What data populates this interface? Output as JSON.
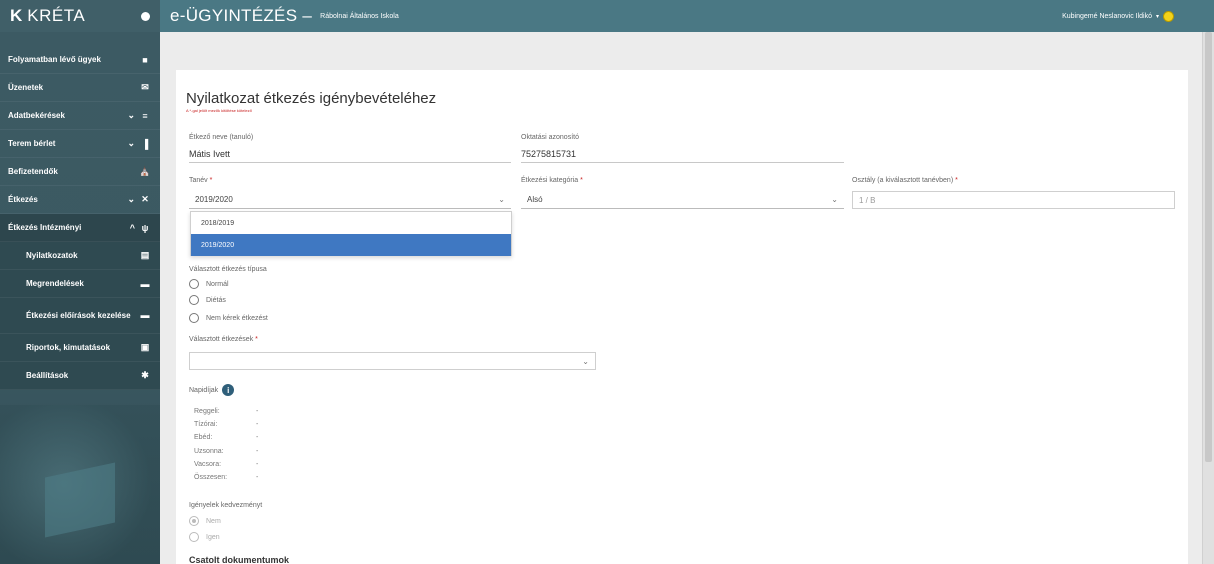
{
  "sidebar": {
    "logo_mark": "K",
    "logo_text": "KRÉTA",
    "items": [
      {
        "label": "Folyamatban lévő ügyek",
        "icon": "square-icon",
        "chev": ""
      },
      {
        "label": "Üzenetek",
        "icon": "envelope-icon",
        "chev": ""
      },
      {
        "label": "Adatbekérések",
        "icon": "list-icon",
        "chev": "⌄"
      },
      {
        "label": "Terem bérlet",
        "icon": "building-icon",
        "chev": "⌄"
      },
      {
        "label": "Befizetendők",
        "icon": "bank-icon",
        "chev": ""
      },
      {
        "label": "Étkezés",
        "icon": "utensils-cross-icon",
        "chev": "⌄"
      },
      {
        "label": "Étkezés Intézményi",
        "icon": "fork-knife-icon",
        "chev": "^"
      }
    ],
    "sub_items": [
      {
        "label": "Nyilatkozatok",
        "icon": "document-icon"
      },
      {
        "label": "Megrendelések",
        "icon": "folder-icon"
      },
      {
        "label": "Étkezési előírások kezelése",
        "icon": "folder-open-icon"
      },
      {
        "label": "Riportok, kimutatások",
        "icon": "report-icon"
      },
      {
        "label": "Beállítások",
        "icon": "gear-icon"
      }
    ]
  },
  "topbar": {
    "app_title": "e-ÜGYINTÉZÉS",
    "separator": "–",
    "school": "Rábolnai Általános Iskola",
    "user": "Kubingemé Neslanovic Ildikó"
  },
  "form": {
    "title": "Nyilatkozat étkezés igénybevételéhez",
    "required_note": "A *-gal jelölt mezők kitöltése kötelező",
    "student_name_label": "Étkező neve (tanuló)",
    "student_name": "Mátis Ivett",
    "edu_id_label": "Oktatási azonosító",
    "edu_id": "75275815731",
    "year_label": "Tanév",
    "year_value": "2019/2020",
    "year_options": [
      "2018/2019",
      "2019/2020"
    ],
    "category_label": "Étkezési kategória",
    "category_value": "Alsó",
    "class_label": "Osztály (a kiválasztott tanévben)",
    "class_value": "1 / B",
    "meal_type_label": "Választott étkezés típusa",
    "meal_types": [
      "Normál",
      "Diétás",
      "Nem kérek étkezést"
    ],
    "meals_label": "Választott étkezések",
    "daily_label": "Napidíjak",
    "prices": [
      {
        "label": "Reggeli:",
        "value": "-"
      },
      {
        "label": "Tízórai:",
        "value": "-"
      },
      {
        "label": "Ebéd:",
        "value": "-"
      },
      {
        "label": "Uzsonna:",
        "value": "-"
      },
      {
        "label": "Vacsora:",
        "value": "-"
      },
      {
        "label": "Összesen:",
        "value": "-"
      }
    ],
    "discount_label": "Igényelek kedvezményt",
    "discount_options": [
      "Nem",
      "Igen"
    ],
    "attachments_label": "Csatolt dokumentumok"
  }
}
